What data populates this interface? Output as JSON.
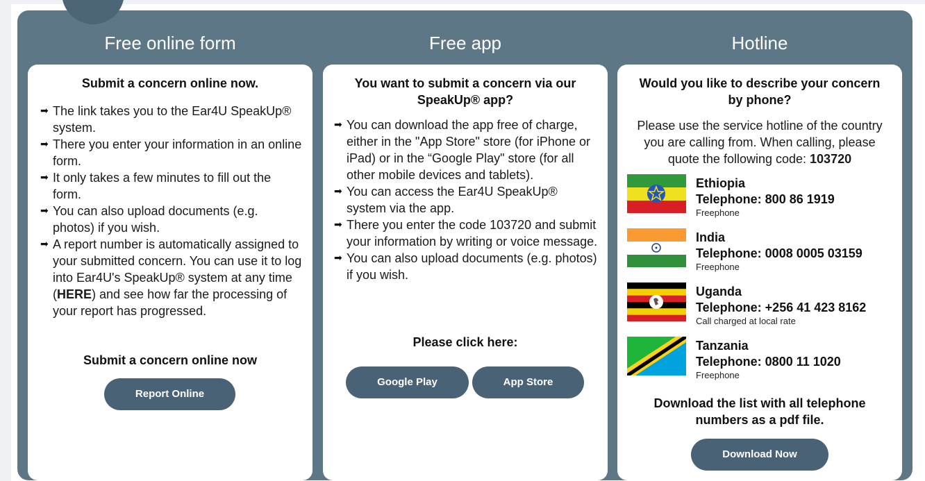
{
  "columns": {
    "online": {
      "title": "Free online form",
      "heading": "Submit a concern online now.",
      "bullets": [
        "The link takes you to the Ear4U SpeakUp® system.",
        "There you enter your information in an online form.",
        "It only takes a few minutes to fill out the form.",
        "You can also upload documents (e.g. photos) if you wish."
      ],
      "bullet5_part1": "A report number is automatically assigned to your submitted concern. You can use it to log into Ear4U's SpeakUp® system at any time (",
      "bullet5_link": "HERE",
      "bullet5_part2": ") and see how far the processing of your report has progressed.",
      "cta_heading": "Submit a concern online now",
      "button_label": "Report Online"
    },
    "app": {
      "title": "Free app",
      "heading": "You want to submit a concern via our SpeakUp® app?",
      "bullets": [
        "You can download the app free of charge, either in the \"App Store\" store (for iPhone or iPad) or in the “Google Play\" store (for all other mobile devices and tablets).",
        "You can access the Ear4U SpeakUp® system via the app.",
        "There you enter the code 103720 and submit your information by writing or voice message.",
        "You can also upload documents (e.g. photos) if you wish."
      ],
      "cta_heading": "Please click here:",
      "google_play_label": "Google Play",
      "app_store_label": "App Store"
    },
    "hotline": {
      "title": "Hotline",
      "heading": "Would you like to describe your concern by phone?",
      "intro": "Please use the service hotline of the country you are calling from. When calling, please quote the following code: ",
      "code": "103720",
      "countries": [
        {
          "name": "Ethiopia",
          "telephone": "Telephone: 800 86 1919",
          "note": "Freephone"
        },
        {
          "name": "India",
          "telephone": "Telephone: 0008 0005 03159",
          "note": "Freephone"
        },
        {
          "name": "Uganda",
          "telephone": "Telephone: +256 41 423 8162",
          "note": "Call charged at local rate"
        },
        {
          "name": "Tanzania",
          "telephone": "Telephone: 0800 11 1020",
          "note": "Freephone"
        }
      ],
      "download_heading": "Download the list with all telephone numbers as a pdf file.",
      "download_label": "Download Now"
    }
  },
  "icons": {
    "bullet": "arrow-right-icon",
    "flags": [
      "ethiopia-flag-icon",
      "india-flag-icon",
      "uganda-flag-icon",
      "tanzania-flag-icon"
    ]
  },
  "colors": {
    "panel": "#5e7787",
    "button": "#4a6276",
    "card": "#ffffff"
  }
}
